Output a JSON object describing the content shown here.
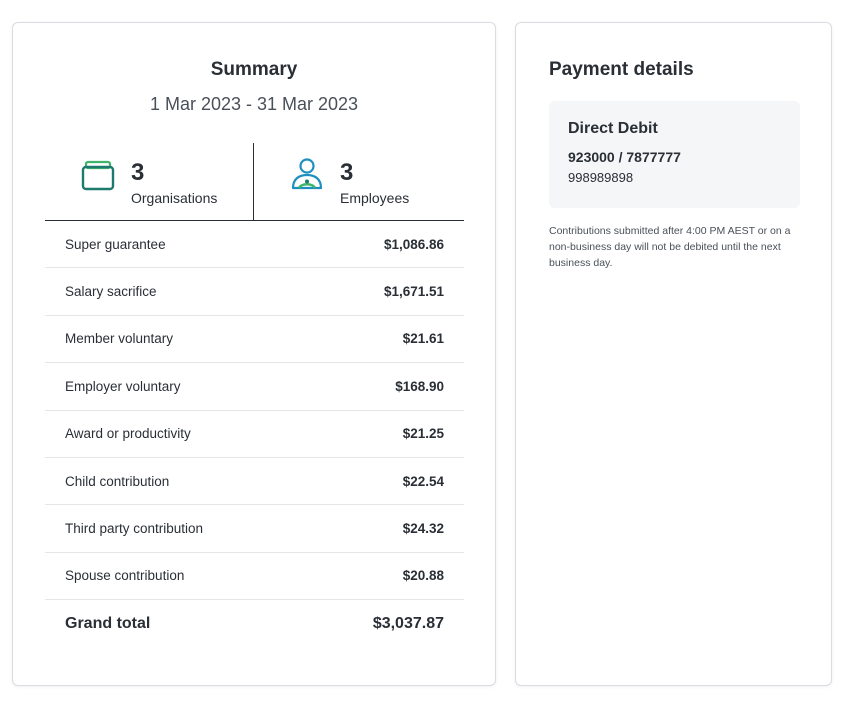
{
  "summary": {
    "title": "Summary",
    "period": "1 Mar 2023 - 31 Mar 2023",
    "stats": {
      "organisations": {
        "value": "3",
        "label": "Organisations",
        "icon": "briefcase-icon"
      },
      "employees": {
        "value": "3",
        "label": "Employees",
        "icon": "person-icon"
      }
    },
    "rows": [
      {
        "label": "Super guarantee",
        "amount": "$1,086.86"
      },
      {
        "label": "Salary sacrifice",
        "amount": "$1,671.51"
      },
      {
        "label": "Member voluntary",
        "amount": "$21.61"
      },
      {
        "label": "Employer voluntary",
        "amount": "$168.90"
      },
      {
        "label": "Award or productivity",
        "amount": "$21.25"
      },
      {
        "label": "Child contribution",
        "amount": "$22.54"
      },
      {
        "label": "Third party contribution",
        "amount": "$24.32"
      },
      {
        "label": "Spouse contribution",
        "amount": "$20.88"
      }
    ],
    "total": {
      "label": "Grand total",
      "amount": "$3,037.87"
    }
  },
  "payment": {
    "title": "Payment details",
    "method": "Direct Debit",
    "bsb_account": "923000 / 7877777",
    "reference": "998989898",
    "note": "Contributions submitted after 4:00 PM AEST or on a non-business day will not be debited until the next business day."
  },
  "colors": {
    "icon_teal": "#1f7a6e",
    "icon_green": "#3fb56b",
    "icon_blue": "#1f8fbf"
  }
}
